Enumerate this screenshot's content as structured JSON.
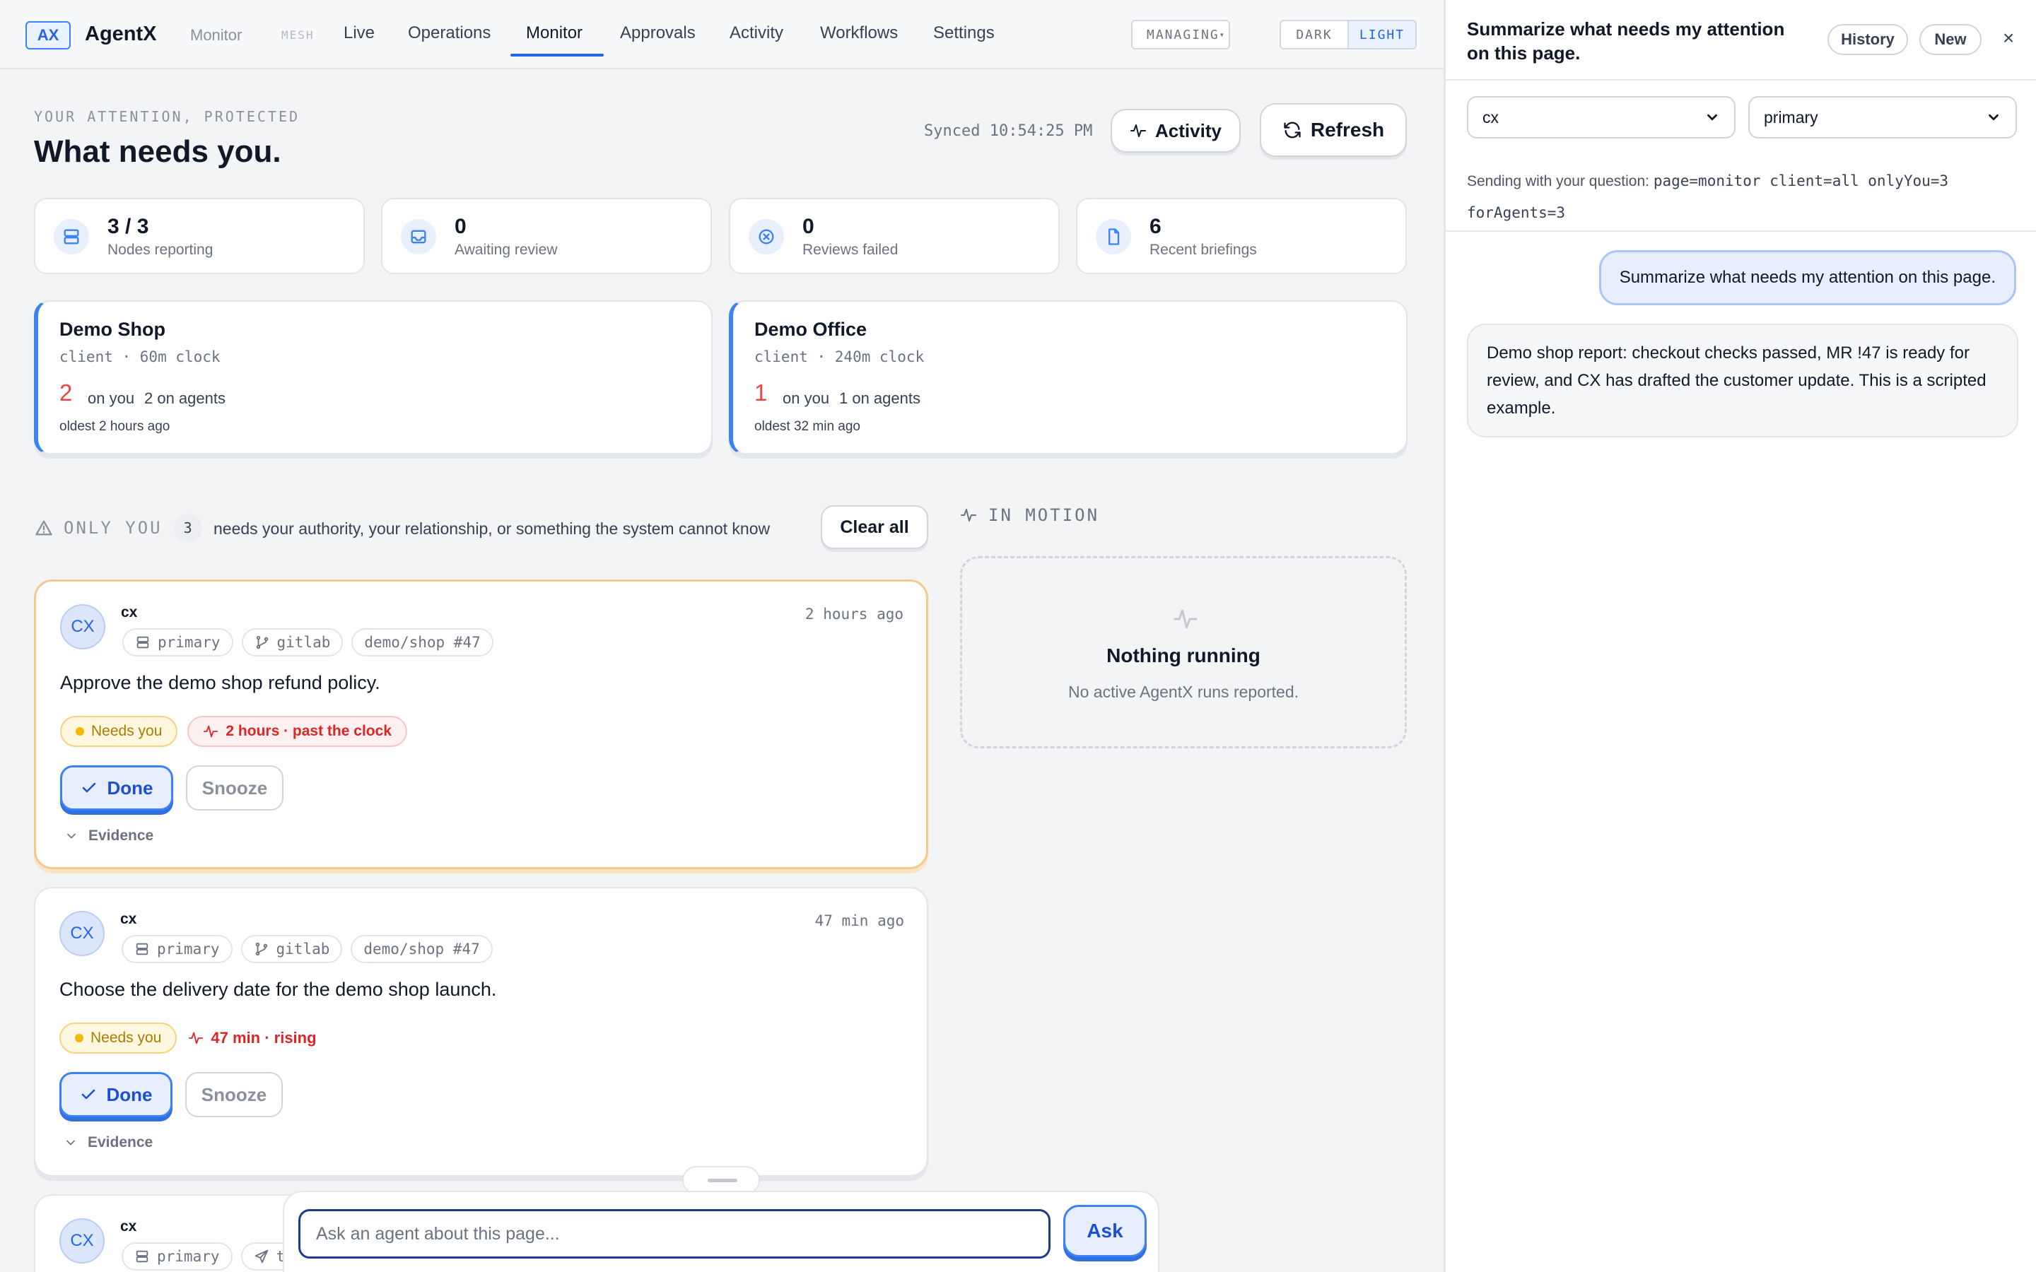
{
  "app": {
    "logo": "AX",
    "name": "AgentX",
    "crumb": "Monitor",
    "mesh": "MESH"
  },
  "nav": {
    "items": [
      "Live",
      "Operations",
      "Monitor",
      "Approvals",
      "Activity",
      "Workflows",
      "Settings"
    ],
    "active": "Monitor"
  },
  "managing": {
    "label": "MANAGING",
    "caret": "▾"
  },
  "theme": {
    "dark": "DARK",
    "light": "LIGHT",
    "selected": "LIGHT"
  },
  "header": {
    "eyebrow": "YOUR ATTENTION, PROTECTED",
    "title": "What needs you.",
    "synced": "Synced 10:54:25 PM",
    "activity_label": "Activity",
    "refresh_label": "Refresh"
  },
  "stats": [
    {
      "value": "3 / 3",
      "label": "Nodes reporting",
      "icon": "server-icon"
    },
    {
      "value": "0",
      "label": "Awaiting review",
      "icon": "inbox-icon"
    },
    {
      "value": "0",
      "label": "Reviews failed",
      "icon": "x-circle-icon"
    },
    {
      "value": "6",
      "label": "Recent briefings",
      "icon": "file-icon"
    }
  ],
  "clients": [
    {
      "name": "Demo Shop",
      "meta": "client · 60m clock",
      "on_you_count": "2",
      "on_you_label": "on you",
      "on_agents": "2 on agents",
      "oldest": "oldest 2 hours ago"
    },
    {
      "name": "Demo Office",
      "meta": "client · 240m clock",
      "on_you_count": "1",
      "on_you_label": "on you",
      "on_agents": "1 on agents",
      "oldest": "oldest 32 min ago"
    }
  ],
  "only_you": {
    "label": "ONLY YOU",
    "count": "3",
    "description": "needs your authority, your relationship, or something the system cannot know",
    "clear_label": "Clear all"
  },
  "in_motion": {
    "label": "IN MOTION",
    "empty_title": "Nothing running",
    "empty_desc": "No active AgentX runs reported."
  },
  "tasks": [
    {
      "avatar": "CX",
      "agent": "cx",
      "tags": [
        "primary",
        "gitlab",
        "demo/shop #47"
      ],
      "time": "2 hours ago",
      "message": "Approve the demo shop refund policy.",
      "status": "Needs you",
      "urgency": "2 hours · past the clock",
      "done": "Done",
      "snooze": "Snooze",
      "evidence": "Evidence"
    },
    {
      "avatar": "CX",
      "agent": "cx",
      "tags": [
        "primary",
        "gitlab",
        "demo/shop #47"
      ],
      "time": "47 min ago",
      "message": "Choose the delivery date for the demo shop launch.",
      "status": "Needs you",
      "urgency": "47 min · rising",
      "done": "Done",
      "snooze": "Snooze",
      "evidence": "Evidence"
    },
    {
      "avatar": "CX",
      "agent": "cx",
      "tags": [
        "primary",
        "te"
      ]
    }
  ],
  "ask": {
    "placeholder": "Ask an agent about this page...",
    "button": "Ask"
  },
  "sidebar": {
    "title": "Summarize what needs my attention on this page.",
    "history": "History",
    "new": "New",
    "close": "×",
    "client_select": "cx",
    "agent_select": "primary",
    "sending_label": "Sending with your question:",
    "sending_params": "page=monitor client=all onlyYou=3 forAgents=3",
    "user_message": "Summarize what needs my attention on this page.",
    "agent_reply": "Demo shop report: checkout checks passed, MR !47 is ready for review, and CX has drafted the customer update. This is a scripted example."
  },
  "colors": {
    "accent": "#2563eb",
    "urgent": "#ef4444",
    "needs_you": "#f5b800",
    "highlight_border": "#f5c98a"
  }
}
